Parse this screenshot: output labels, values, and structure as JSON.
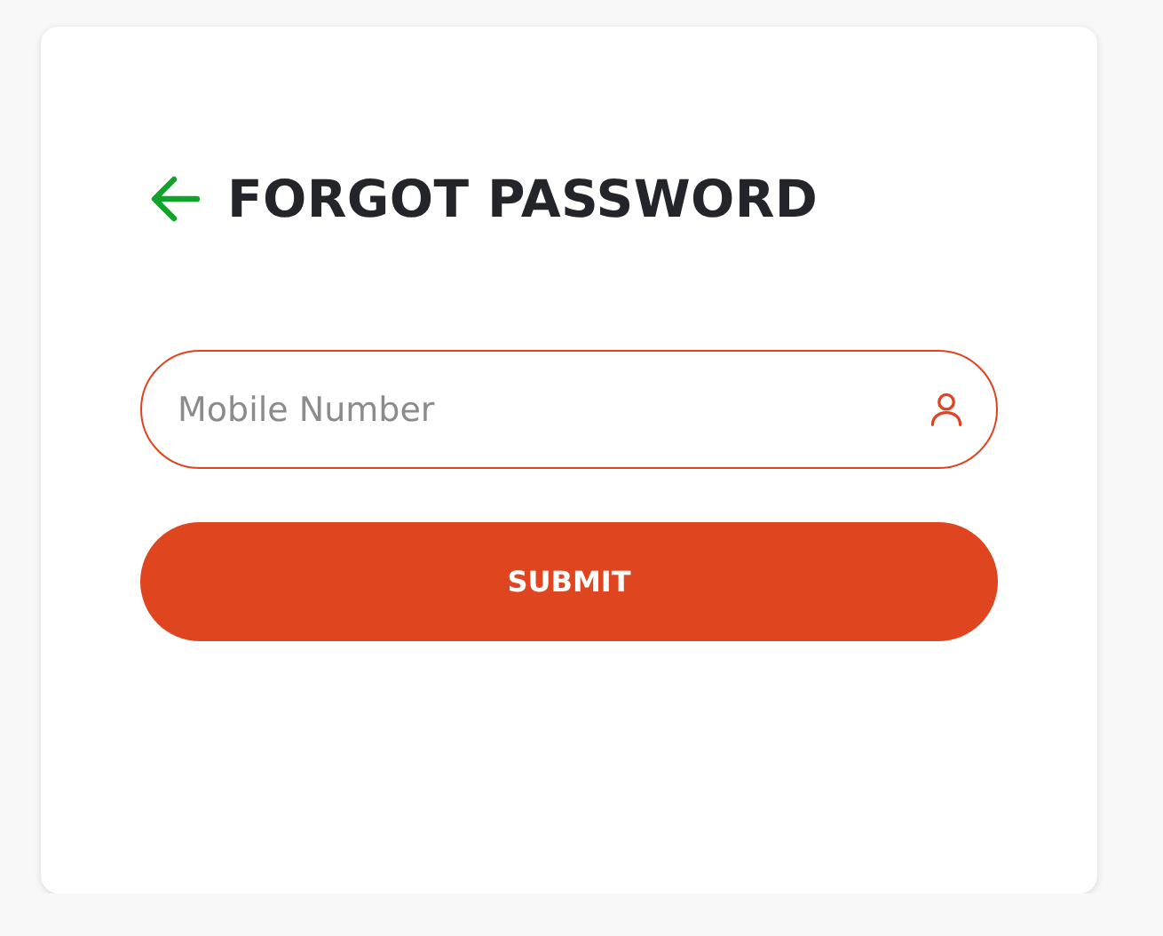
{
  "title": "FORGOT PASSWORD",
  "mobile_field": {
    "placeholder": "Mobile Number"
  },
  "submit_button": {
    "label": "SUBMIT"
  }
}
